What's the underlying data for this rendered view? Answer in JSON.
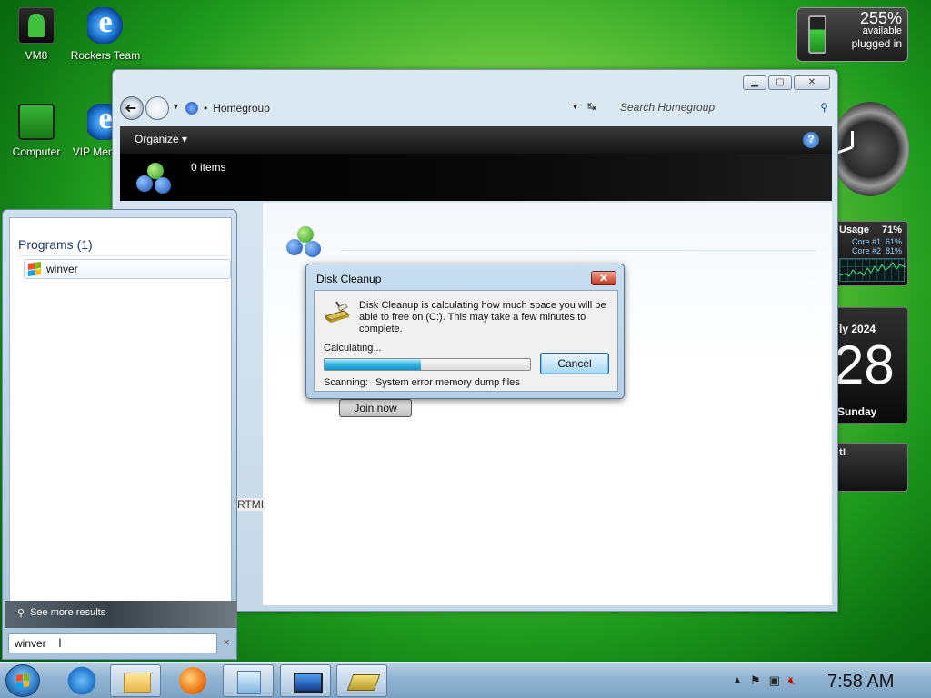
{
  "desktop": {
    "icons": [
      {
        "label": "VM8"
      },
      {
        "label": "Rockers Team"
      },
      {
        "label": "Computer"
      },
      {
        "label": "VIP Members"
      }
    ]
  },
  "explorer": {
    "address_crumb": "Homegroup",
    "search_placeholder": "Search Homegroup",
    "toolbar": {
      "organize": "Organize",
      "organize_caret": "▾",
      "help": "?"
    },
    "details": {
      "count": "0 items"
    },
    "content": {
      "join_button": "Join now",
      "partial_label": "RTMI"
    }
  },
  "dialog": {
    "title": "Disk Cleanup",
    "close": "✕",
    "message": "Disk Cleanup is calculating how much space you will be able to free on  (C:). This may take a few minutes to complete.",
    "status": "Calculating...",
    "progress": 0.47,
    "cancel": "Cancel",
    "scanning_label": "Scanning:",
    "scanning_item": "System error memory dump files"
  },
  "gadgets": {
    "battery": {
      "percent": "255%",
      "available": "available",
      "state": "plugged in"
    },
    "cpu": {
      "title": "Usage",
      "total": "71%",
      "core1_label": "Core #1",
      "core1": "61%",
      "core2_label": "Core #2",
      "core2": "81%"
    },
    "calendar": {
      "month": "ly 2024",
      "day": "28",
      "weekday": "Sunday"
    },
    "nvidia": {
      "text": "t!"
    }
  },
  "start_menu": {
    "section": "Programs (1)",
    "result": "winver",
    "see_more": "See more results",
    "search_value": "winver",
    "clear": "×"
  },
  "taskbar": {
    "clock": "7:58 AM",
    "tray_up": "▲"
  },
  "colors": {
    "accent": "#1d3a73",
    "progress_fill": "#3ab6e6",
    "close_red": "#c2361c"
  }
}
